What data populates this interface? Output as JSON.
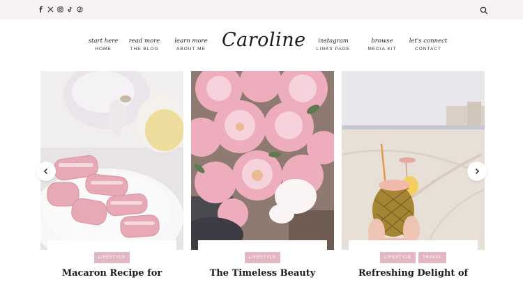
{
  "brand": {
    "logo": "Caroline"
  },
  "topbar": {
    "social_icons": [
      "facebook-icon",
      "x-icon",
      "instagram-icon",
      "tiktok-icon",
      "pinterest-icon"
    ],
    "search_icon": "search-icon"
  },
  "nav": {
    "left": [
      {
        "script": "start here",
        "label": "HOME"
      },
      {
        "script": "read more",
        "label": "THE BLOG"
      },
      {
        "script": "learn more",
        "label": "ABOUT ME"
      }
    ],
    "right": [
      {
        "script": "instagram",
        "label": "LINKS PAGE"
      },
      {
        "script": "browse",
        "label": "MEDIA KIT"
      },
      {
        "script": "let's connect",
        "label": "CONTACT"
      }
    ]
  },
  "carousel": {
    "prev_icon": "chevron-left-icon",
    "next_icon": "chevron-right-icon",
    "posts": [
      {
        "tags": [
          "LIFESTYLE"
        ],
        "title": "Macaron Recipe for",
        "image": "macarons-and-tea-photo"
      },
      {
        "tags": [
          "LIFESTYLE"
        ],
        "title": "The Timeless Beauty",
        "image": "peony-bouquet-photo"
      },
      {
        "tags": [
          "LIFESTYLE",
          "TRAVEL"
        ],
        "title": "Refreshing Delight of",
        "image": "pineapple-drink-beach-photo"
      }
    ]
  },
  "colors": {
    "topbar": "#f6f2f2",
    "tag": "#e2b7c1",
    "text": "#222222"
  }
}
